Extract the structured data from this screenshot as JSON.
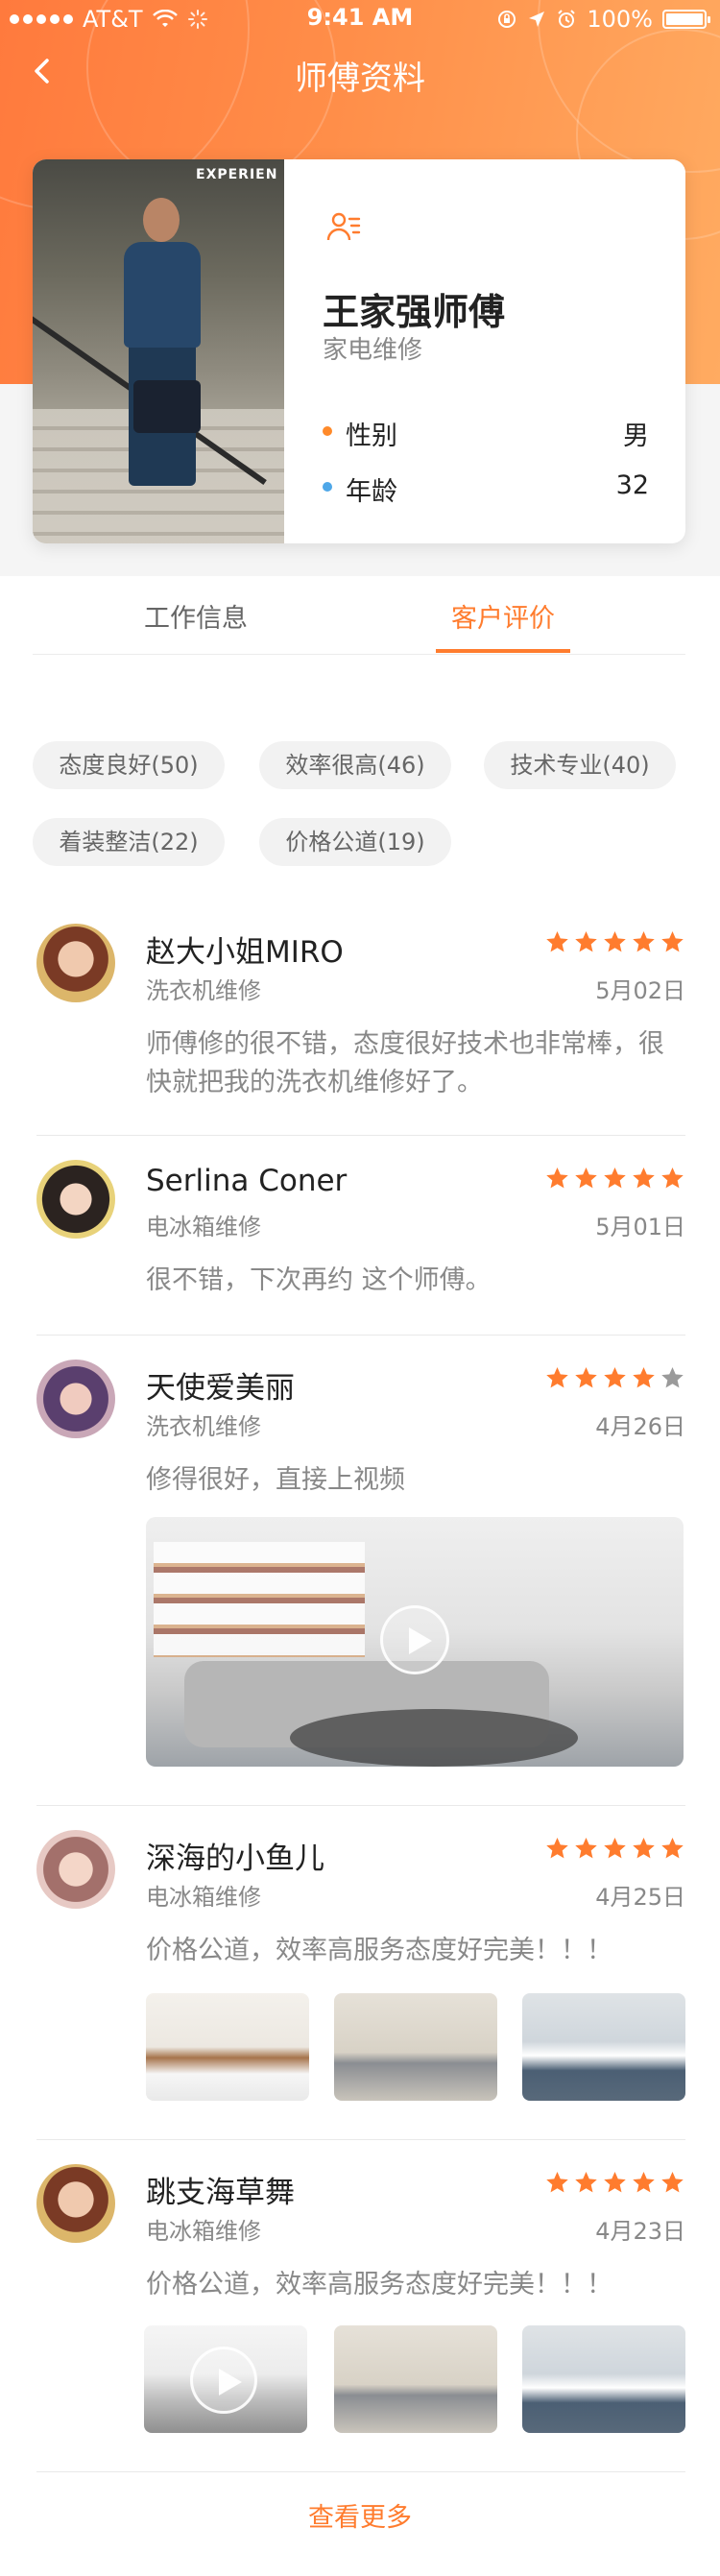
{
  "status_bar": {
    "carrier": "AT&T",
    "time": "9:41 AM",
    "battery": "100%"
  },
  "nav": {
    "title": "师傅资料",
    "back_icon": "chevron-left-icon"
  },
  "profile": {
    "photo_sign": "EXPERIEN",
    "name": "王家强师傅",
    "category": "家电维修",
    "gender_label": "性别",
    "gender_value": "男",
    "age_label": "年龄",
    "age_value": "32",
    "gender_dot_color": "#ff8a2a",
    "age_dot_color": "#4ea7e8"
  },
  "tabs": [
    {
      "label": "工作信息",
      "active": false
    },
    {
      "label": "客户评价",
      "active": true
    }
  ],
  "tags": [
    "态度良好(50)",
    "效率很高(46)",
    "技术专业(40)",
    "着装整洁(22)",
    "价格公道(19)"
  ],
  "reviews": [
    {
      "name": "赵大小姐MIRO",
      "type": "洗衣机维修",
      "date": "5月02日",
      "rating": 5,
      "text": "师傅修的很不错，态度很好技术也非常棒，很快就把我的洗衣机维修好了。",
      "media": "none"
    },
    {
      "name": "Serlina Coner",
      "type": "电冰箱维修",
      "date": "5月01日",
      "rating": 5,
      "text": "很不错，下次再约 这个师傅。",
      "media": "none"
    },
    {
      "name": "天使爱美丽",
      "type": "洗衣机维修",
      "date": "4月26日",
      "rating": 4,
      "text": "修得很好，直接上视频",
      "media": "video"
    },
    {
      "name": "深海的小鱼儿",
      "type": "电冰箱维修",
      "date": "4月25日",
      "rating": 5,
      "text": "价格公道，效率高服务态度好完美！！！",
      "media": "photos"
    },
    {
      "name": "跳支海草舞",
      "type": "电冰箱维修",
      "date": "4月23日",
      "rating": 5,
      "text": "价格公道，效率高服务态度好完美！！！",
      "media": "photos-with-video"
    }
  ],
  "view_more": "查看更多",
  "colors": {
    "accent": "#ff7c2e",
    "star_filled": "#ff7c2e",
    "star_empty": "#9a9a9a"
  }
}
